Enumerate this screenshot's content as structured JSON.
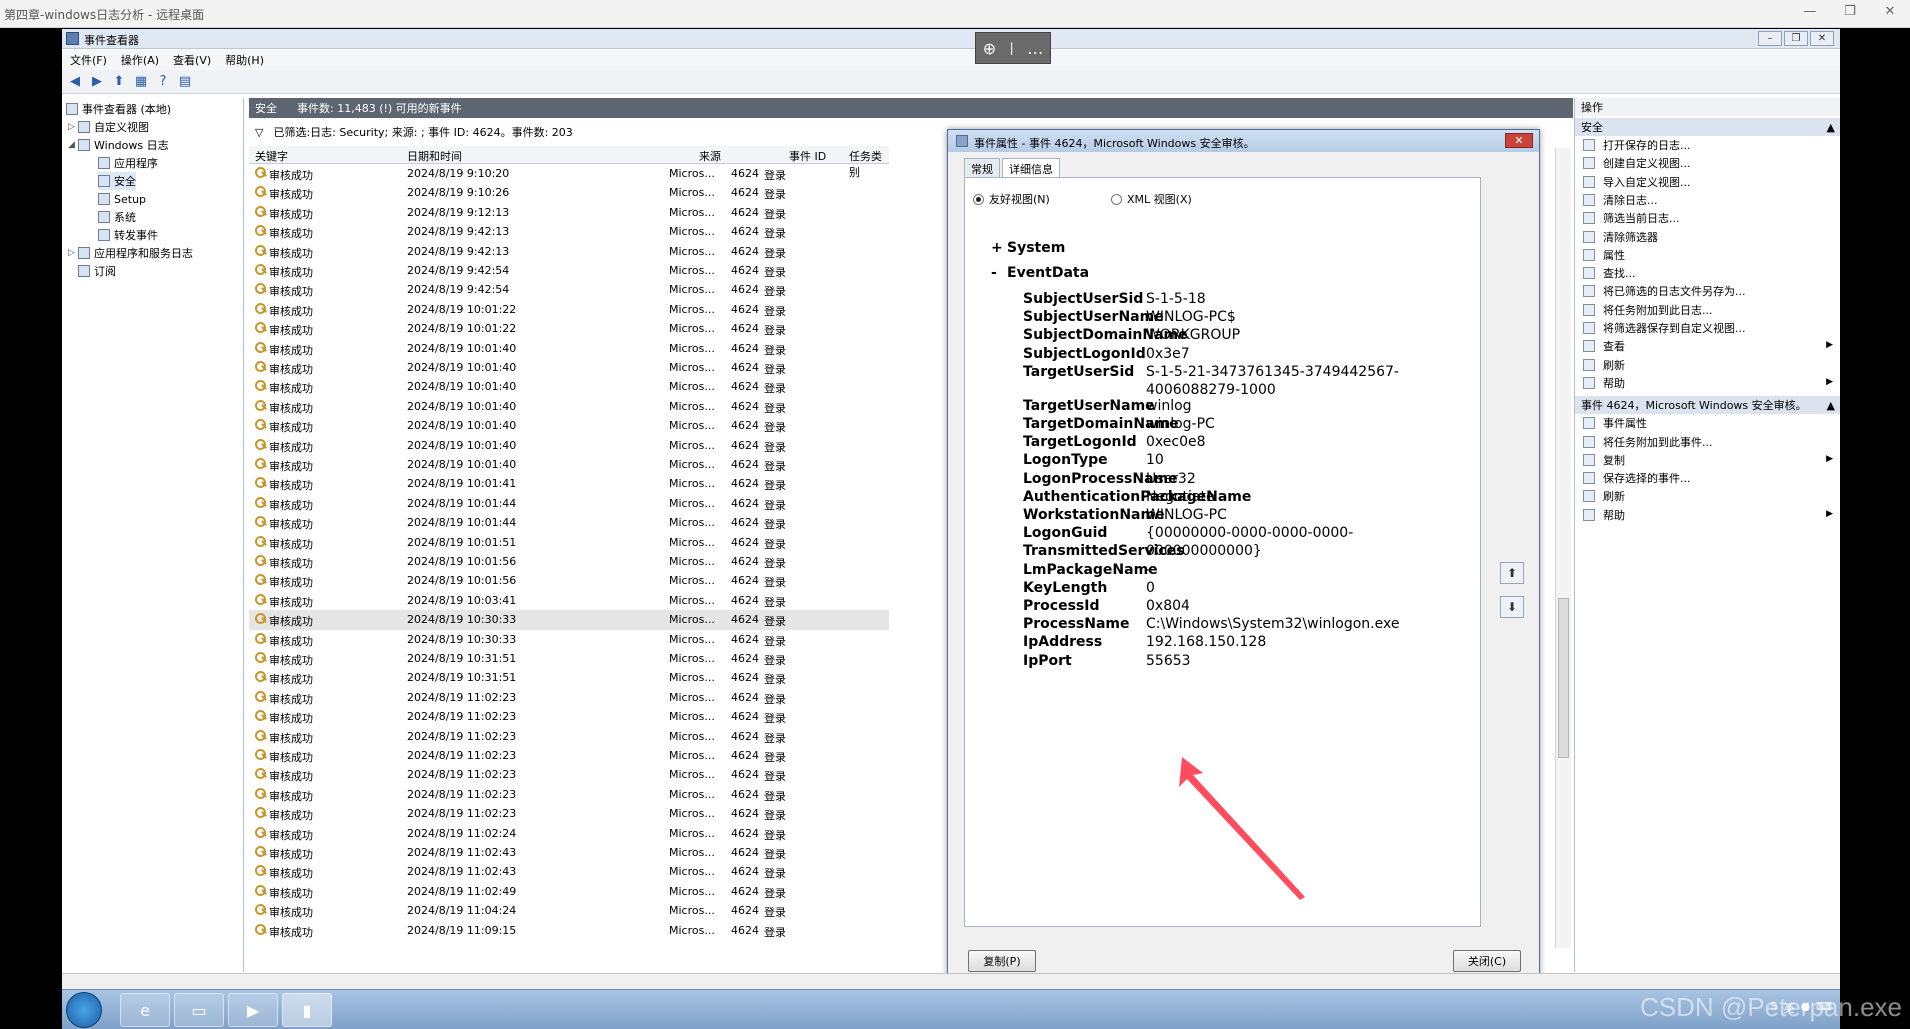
{
  "rdp": {
    "title": "第四章-windows日志分析 - 远程桌面",
    "zoom_icon": "zoom-in-icon",
    "more": "…"
  },
  "app": {
    "title": "事件查看器"
  },
  "menu": [
    "文件(F)",
    "操作(A)",
    "查看(V)",
    "帮助(H)"
  ],
  "tree": {
    "root": "事件查看器 (本地)",
    "custom": "自定义视图",
    "winlogs": "Windows 日志",
    "app": "应用程序",
    "security": "安全",
    "setup": "Setup",
    "system": "系统",
    "forwarded": "转发事件",
    "appsvc": "应用程序和服务日志",
    "subs": "订阅"
  },
  "mid": {
    "tab": "安全",
    "info": "事件数: 11,483 (!) 可用的新事件",
    "filter": "已筛选:日志: Security; 来源: ; 事件 ID: 4624。事件数: 203"
  },
  "columns": [
    "关键字",
    "日期和时间",
    "来源",
    "事件 ID",
    "任务类别"
  ],
  "rows": [
    {
      "k": "审核成功",
      "t": "2024/8/19 9:10:20",
      "s": "Micros...",
      "id": "4624",
      "c": "登录"
    },
    {
      "k": "审核成功",
      "t": "2024/8/19 9:10:26",
      "s": "Micros...",
      "id": "4624",
      "c": "登录"
    },
    {
      "k": "审核成功",
      "t": "2024/8/19 9:12:13",
      "s": "Micros...",
      "id": "4624",
      "c": "登录"
    },
    {
      "k": "审核成功",
      "t": "2024/8/19 9:42:13",
      "s": "Micros...",
      "id": "4624",
      "c": "登录"
    },
    {
      "k": "审核成功",
      "t": "2024/8/19 9:42:13",
      "s": "Micros...",
      "id": "4624",
      "c": "登录"
    },
    {
      "k": "审核成功",
      "t": "2024/8/19 9:42:54",
      "s": "Micros...",
      "id": "4624",
      "c": "登录"
    },
    {
      "k": "审核成功",
      "t": "2024/8/19 9:42:54",
      "s": "Micros...",
      "id": "4624",
      "c": "登录"
    },
    {
      "k": "审核成功",
      "t": "2024/8/19 10:01:22",
      "s": "Micros...",
      "id": "4624",
      "c": "登录"
    },
    {
      "k": "审核成功",
      "t": "2024/8/19 10:01:22",
      "s": "Micros...",
      "id": "4624",
      "c": "登录"
    },
    {
      "k": "审核成功",
      "t": "2024/8/19 10:01:40",
      "s": "Micros...",
      "id": "4624",
      "c": "登录"
    },
    {
      "k": "审核成功",
      "t": "2024/8/19 10:01:40",
      "s": "Micros...",
      "id": "4624",
      "c": "登录"
    },
    {
      "k": "审核成功",
      "t": "2024/8/19 10:01:40",
      "s": "Micros...",
      "id": "4624",
      "c": "登录"
    },
    {
      "k": "审核成功",
      "t": "2024/8/19 10:01:40",
      "s": "Micros...",
      "id": "4624",
      "c": "登录"
    },
    {
      "k": "审核成功",
      "t": "2024/8/19 10:01:40",
      "s": "Micros...",
      "id": "4624",
      "c": "登录"
    },
    {
      "k": "审核成功",
      "t": "2024/8/19 10:01:40",
      "s": "Micros...",
      "id": "4624",
      "c": "登录"
    },
    {
      "k": "审核成功",
      "t": "2024/8/19 10:01:40",
      "s": "Micros...",
      "id": "4624",
      "c": "登录"
    },
    {
      "k": "审核成功",
      "t": "2024/8/19 10:01:41",
      "s": "Micros...",
      "id": "4624",
      "c": "登录"
    },
    {
      "k": "审核成功",
      "t": "2024/8/19 10:01:44",
      "s": "Micros...",
      "id": "4624",
      "c": "登录"
    },
    {
      "k": "审核成功",
      "t": "2024/8/19 10:01:44",
      "s": "Micros...",
      "id": "4624",
      "c": "登录"
    },
    {
      "k": "审核成功",
      "t": "2024/8/19 10:01:51",
      "s": "Micros...",
      "id": "4624",
      "c": "登录"
    },
    {
      "k": "审核成功",
      "t": "2024/8/19 10:01:56",
      "s": "Micros...",
      "id": "4624",
      "c": "登录"
    },
    {
      "k": "审核成功",
      "t": "2024/8/19 10:01:56",
      "s": "Micros...",
      "id": "4624",
      "c": "登录"
    },
    {
      "k": "审核成功",
      "t": "2024/8/19 10:03:41",
      "s": "Micros...",
      "id": "4624",
      "c": "登录"
    },
    {
      "k": "审核成功",
      "t": "2024/8/19 10:30:33",
      "s": "Micros...",
      "id": "4624",
      "c": "登录",
      "sel": true
    },
    {
      "k": "审核成功",
      "t": "2024/8/19 10:30:33",
      "s": "Micros...",
      "id": "4624",
      "c": "登录"
    },
    {
      "k": "审核成功",
      "t": "2024/8/19 10:31:51",
      "s": "Micros...",
      "id": "4624",
      "c": "登录"
    },
    {
      "k": "审核成功",
      "t": "2024/8/19 10:31:51",
      "s": "Micros...",
      "id": "4624",
      "c": "登录"
    },
    {
      "k": "审核成功",
      "t": "2024/8/19 11:02:23",
      "s": "Micros...",
      "id": "4624",
      "c": "登录"
    },
    {
      "k": "审核成功",
      "t": "2024/8/19 11:02:23",
      "s": "Micros...",
      "id": "4624",
      "c": "登录"
    },
    {
      "k": "审核成功",
      "t": "2024/8/19 11:02:23",
      "s": "Micros...",
      "id": "4624",
      "c": "登录"
    },
    {
      "k": "审核成功",
      "t": "2024/8/19 11:02:23",
      "s": "Micros...",
      "id": "4624",
      "c": "登录"
    },
    {
      "k": "审核成功",
      "t": "2024/8/19 11:02:23",
      "s": "Micros...",
      "id": "4624",
      "c": "登录"
    },
    {
      "k": "审核成功",
      "t": "2024/8/19 11:02:23",
      "s": "Micros...",
      "id": "4624",
      "c": "登录"
    },
    {
      "k": "审核成功",
      "t": "2024/8/19 11:02:23",
      "s": "Micros...",
      "id": "4624",
      "c": "登录"
    },
    {
      "k": "审核成功",
      "t": "2024/8/19 11:02:24",
      "s": "Micros...",
      "id": "4624",
      "c": "登录"
    },
    {
      "k": "审核成功",
      "t": "2024/8/19 11:02:43",
      "s": "Micros...",
      "id": "4624",
      "c": "登录"
    },
    {
      "k": "审核成功",
      "t": "2024/8/19 11:02:43",
      "s": "Micros...",
      "id": "4624",
      "c": "登录"
    },
    {
      "k": "审核成功",
      "t": "2024/8/19 11:02:49",
      "s": "Micros...",
      "id": "4624",
      "c": "登录"
    },
    {
      "k": "审核成功",
      "t": "2024/8/19 11:04:24",
      "s": "Micros...",
      "id": "4624",
      "c": "登录"
    },
    {
      "k": "审核成功",
      "t": "2024/8/19 11:09:15",
      "s": "Micros...",
      "id": "4624",
      "c": "登录"
    }
  ],
  "dialog": {
    "title": "事件属性 - 事件 4624，Microsoft Windows 安全审核。",
    "tab_general": "常规",
    "tab_details": "详细信息",
    "friendly": "友好视图(N)",
    "xml": "XML 视图(X)",
    "system": "System",
    "eventdata": "EventData",
    "fields": [
      {
        "k": "SubjectUserSid",
        "v": "S-1-5-18"
      },
      {
        "k": "SubjectUserName",
        "v": "WINLOG-PC$"
      },
      {
        "k": "SubjectDomainName",
        "v": "WORKGROUP"
      },
      {
        "k": "SubjectLogonId",
        "v": "0x3e7"
      },
      {
        "k": "TargetUserSid",
        "v": "S-1-5-21-3473761345-3749442567-4006088279-1000"
      },
      {
        "k": "TargetUserName",
        "v": "winlog"
      },
      {
        "k": "TargetDomainName",
        "v": "winlog-PC"
      },
      {
        "k": "TargetLogonId",
        "v": "0xec0e8"
      },
      {
        "k": "LogonType",
        "v": "10"
      },
      {
        "k": "LogonProcessName",
        "v": "User32"
      },
      {
        "k": "AuthenticationPackageName",
        "v": "Negotiate"
      },
      {
        "k": "WorkstationName",
        "v": "WINLOG-PC"
      },
      {
        "k": "LogonGuid",
        "v": "{00000000-0000-0000-0000-000000000000}"
      },
      {
        "k": "TransmittedServices",
        "v": "-"
      },
      {
        "k": "LmPackageName",
        "v": "-"
      },
      {
        "k": "KeyLength",
        "v": "0"
      },
      {
        "k": "ProcessId",
        "v": "0x804"
      },
      {
        "k": "ProcessName",
        "v": "C:\\Windows\\System32\\winlogon.exe"
      },
      {
        "k": "IpAddress",
        "v": "192.168.150.128"
      },
      {
        "k": "IpPort",
        "v": "55653"
      }
    ],
    "copy": "复制(P)",
    "close": "关闭(C)"
  },
  "actions": {
    "head": "操作",
    "sec1": "安全",
    "items1": [
      "打开保存的日志...",
      "创建自定义视图...",
      "导入自定义视图...",
      "清除日志...",
      "筛选当前日志...",
      "清除筛选器",
      "属性",
      "查找...",
      "将已筛选的日志文件另存为...",
      "将任务附加到此日志...",
      "将筛选器保存到自定义视图...",
      "查看",
      "刷新",
      "帮助"
    ],
    "sec2": "事件 4624，Microsoft Windows 安全审核。",
    "items2": [
      "事件属性",
      "将任务附加到此事件...",
      "复制",
      "保存选择的事件...",
      "刷新",
      "帮助"
    ]
  },
  "watermark": "CSDN @Peterpan.exe",
  "tray_lang": "英"
}
